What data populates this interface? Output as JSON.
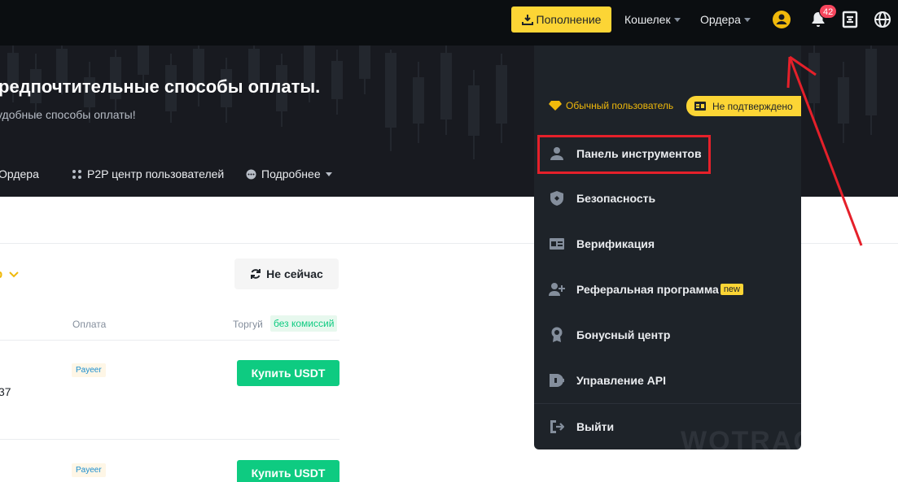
{
  "header": {
    "deposit_label": "Пополнение",
    "wallet_label": "Кошелек",
    "orders_label": "Ордера",
    "notification_count": "42",
    "icons": [
      "user-icon",
      "bell-icon",
      "download-app-icon",
      "globe-icon"
    ]
  },
  "hero": {
    "title": "редпочтительные способы оплаты.",
    "subtitle": "удобные способы оплаты!",
    "nav": {
      "orders": "Ордера",
      "p2p_center": "P2P центр пользователей",
      "more": "Подробнее"
    }
  },
  "content": {
    "filter_fragment": "р",
    "not_now_label": "Не сейчас",
    "columns": {
      "payment": "Оплата",
      "trade": "Торгуй",
      "fee_tag": "без комиссий"
    },
    "rows": [
      {
        "payment": "Payeer",
        "number_fragment": "37",
        "buy_label": "Купить USDT"
      },
      {
        "payment": "Payeer",
        "buy_label": "Купить USDT"
      }
    ]
  },
  "user_menu": {
    "user_type": "Обычный пользователь",
    "verification_status": "Не подтверждено",
    "items": [
      {
        "label": "Панель инструментов",
        "icon": "user-icon"
      },
      {
        "label": "Безопасность",
        "icon": "shield-icon"
      },
      {
        "label": "Верификация",
        "icon": "id-card-icon"
      },
      {
        "label": "Реферальная программа",
        "icon": "add-user-icon",
        "tag": "new"
      },
      {
        "label": "Бонусный центр",
        "icon": "medal-icon"
      },
      {
        "label": "Управление API",
        "icon": "api-icon"
      }
    ],
    "logout_label": "Выйти",
    "watermark": "WOTRAC"
  },
  "colors": {
    "brand_yellow": "#fcd535",
    "buy_green": "#0ecb81",
    "annotation_red": "#e5202a",
    "header_bg": "#0b0e11",
    "menu_bg": "#1e2329"
  }
}
